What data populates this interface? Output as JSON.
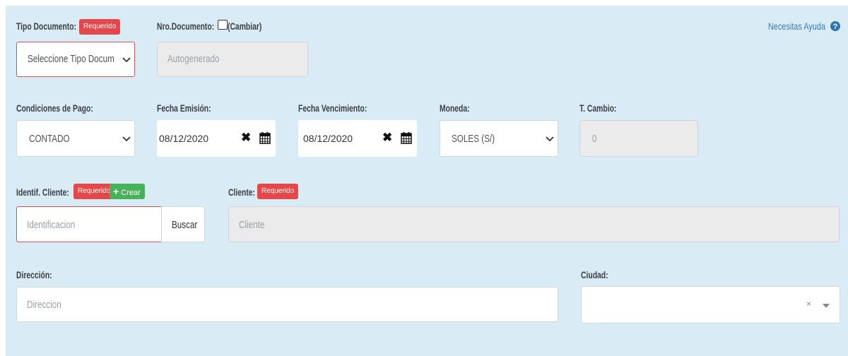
{
  "help": {
    "label": "Necesitas Ayuda"
  },
  "badges": {
    "required": "Requerido",
    "create": "Crear"
  },
  "tipo_documento": {
    "label": "Tipo Documento:",
    "selected": "Seleccione Tipo Docum"
  },
  "nro_documento": {
    "label": "Nro.Documento:",
    "toggle_label": "(Cambiar)",
    "checked": false,
    "value": "Autogenerado"
  },
  "condiciones_pago": {
    "label": "Condiciones de Pago:",
    "selected": "CONTADO"
  },
  "fecha_emision": {
    "label": "Fecha Emisión:",
    "value": "08/12/2020"
  },
  "fecha_vencimiento": {
    "label": "Fecha Vencimiento:",
    "value": "08/12/2020"
  },
  "moneda": {
    "label": "Moneda:",
    "selected": "SOLES (S/)"
  },
  "tipo_cambio": {
    "label": "T. Cambio:",
    "value": "0"
  },
  "identif_cliente": {
    "label": "Identif. Cliente:",
    "placeholder": "Identificacion",
    "search_button": "Buscar"
  },
  "cliente": {
    "label": "Cliente:",
    "placeholder": "Cliente"
  },
  "direccion": {
    "label": "Dirección:",
    "placeholder": "Direccion"
  },
  "ciudad": {
    "label": "Ciudad:",
    "selected": "",
    "clear_glyph": "×"
  },
  "colors": {
    "panel_bg": "#d9ebf5",
    "required_badge": "#e3494b",
    "create_badge": "#46b35a",
    "error_border": "#c9555a",
    "link": "#3a7db6"
  }
}
